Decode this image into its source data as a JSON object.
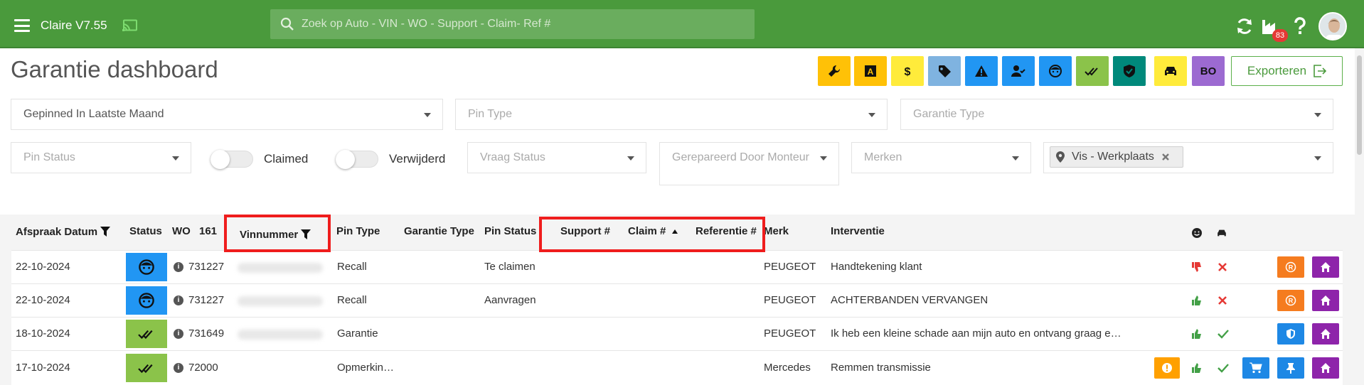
{
  "app": {
    "title": "Claire V7.55",
    "notification_count": "83"
  },
  "search": {
    "placeholder": "Zoek op Auto - VIN - WO - Support - Claim- Ref #"
  },
  "page": {
    "title": "Garantie dashboard",
    "export_label": "Exporteren"
  },
  "quick_filters": [
    {
      "icon": "wrench-icon",
      "color": "#ffc107"
    },
    {
      "icon": "letter-a-icon",
      "color": "#ffc107"
    },
    {
      "icon": "dollar-icon",
      "color": "#ffeb3b"
    },
    {
      "icon": "tag-icon",
      "color": "#7fb3e0"
    },
    {
      "icon": "warning-icon",
      "color": "#2196f3"
    },
    {
      "icon": "user-check-icon",
      "color": "#2196f3"
    },
    {
      "icon": "face-icon",
      "color": "#2196f3"
    },
    {
      "icon": "double-check-icon",
      "color": "#8bc34a"
    },
    {
      "icon": "shield-check-icon",
      "color": "#00897b"
    },
    {
      "icon": "car-icon",
      "color": "#ffeb3b"
    },
    {
      "label": "BO",
      "color": "#9c6ad1"
    }
  ],
  "filters": {
    "period": "Gepinned In Laatste Maand",
    "pin_type": "Pin Type",
    "garantie_type": "Garantie Type",
    "pin_status": "Pin Status",
    "claimed_label": "Claimed",
    "verwijderd_label": "Verwijderd",
    "vraag_status": "Vraag Status",
    "gerepareerd_door": "Gerepareerd Door Monteur",
    "merken": "Merken",
    "location_chip": "Vis - Werkplaats"
  },
  "table": {
    "headers": {
      "afspraak_datum": "Afspraak Datum",
      "status": "Status",
      "wo": "WO",
      "wo_count": "161",
      "vinnummer": "Vinnummer",
      "pin_type": "Pin Type",
      "garantie_type": "Garantie Type",
      "pin_status": "Pin Status",
      "support": "Support #",
      "claim": "Claim #",
      "referentie": "Referentie #",
      "merk": "Merk",
      "interventie": "Interventie"
    },
    "rows": [
      {
        "date": "22-10-2024",
        "status_icon": "face-icon",
        "status_color": "#2196f3",
        "wo": "731227",
        "pin_type": "Recall",
        "pin_status": "Te claimen",
        "merk": "PEUGEOT",
        "interventie": "Handtekening klant",
        "thumb": "down",
        "car_ok": false,
        "actions": [
          "registered-icon",
          "home-icon"
        ]
      },
      {
        "date": "22-10-2024",
        "status_icon": "face-icon",
        "status_color": "#2196f3",
        "wo": "731227",
        "pin_type": "Recall",
        "pin_status": "Aanvragen",
        "merk": "PEUGEOT",
        "interventie": "ACHTERBANDEN VERVANGEN",
        "thumb": "up",
        "car_ok": false,
        "actions": [
          "registered-icon",
          "home-icon"
        ]
      },
      {
        "date": "18-10-2024",
        "status_icon": "double-check-icon",
        "status_color": "#8bc34a",
        "wo": "731649",
        "pin_type": "Garantie",
        "pin_status": "",
        "merk": "PEUGEOT",
        "interventie": "Ik heb een kleine schade aan mijn auto en ontvang graag e…",
        "thumb": "up",
        "car_ok": true,
        "actions": [
          "shield-icon",
          "home-icon"
        ]
      },
      {
        "date": "17-10-2024",
        "status_icon": "double-check-icon",
        "status_color": "#8bc34a",
        "wo": "72000",
        "pin_type": "Opmerkin…",
        "pin_status": "",
        "merk": "Mercedes",
        "interventie": "Remmen transmissie",
        "thumb": "up",
        "car_ok": true,
        "actions": [
          "cart-icon",
          "pin-icon",
          "home-icon"
        ]
      }
    ]
  }
}
